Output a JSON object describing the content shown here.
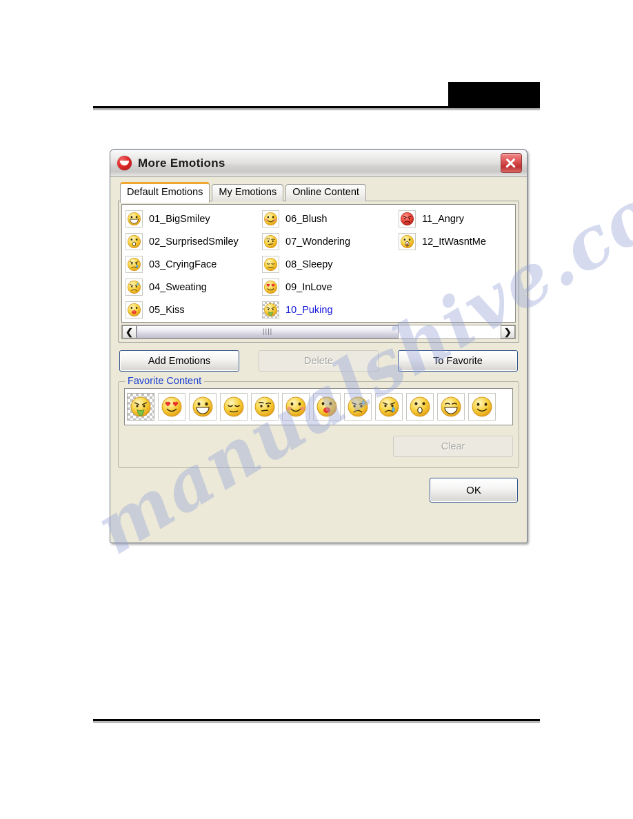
{
  "page": {
    "watermark": "manualshive.com",
    "has_top_rule": true,
    "has_bottom_rule": true,
    "redaction_block": true
  },
  "dialog": {
    "title": "More Emotions",
    "title_icon": "red-smiley-shield-icon",
    "close_label": "✕",
    "tabs": [
      {
        "label": "Default Emotions",
        "active": true
      },
      {
        "label": "My Emotions",
        "active": false
      },
      {
        "label": "Online Content",
        "active": false
      }
    ],
    "emotions": [
      {
        "name": "01_BigSmiley",
        "face": "big-smiley",
        "selected": false
      },
      {
        "name": "02_SurprisedSmiley",
        "face": "surprised",
        "selected": false
      },
      {
        "name": "03_CryingFace",
        "face": "crying",
        "selected": false
      },
      {
        "name": "04_Sweating",
        "face": "sweating",
        "selected": false
      },
      {
        "name": "05_Kiss",
        "face": "kiss",
        "selected": false
      },
      {
        "name": "06_Blush",
        "face": "blush",
        "selected": false
      },
      {
        "name": "07_Wondering",
        "face": "wondering",
        "selected": false
      },
      {
        "name": "08_Sleepy",
        "face": "sleepy",
        "selected": false
      },
      {
        "name": "09_InLove",
        "face": "in-love",
        "selected": false
      },
      {
        "name": "10_Puking",
        "face": "puking",
        "selected": true
      },
      {
        "name": "11_Angry",
        "face": "angry",
        "selected": false
      },
      {
        "name": "12_ItWasntMe",
        "face": "it-wasnt-me",
        "selected": false
      }
    ],
    "scrollbar": {
      "left_arrow": "❮",
      "right_arrow": "❯",
      "grip": "||||",
      "thumb_percent": 72
    },
    "buttons": {
      "add_emotions": {
        "label": "Add Emotions",
        "disabled": false
      },
      "delete": {
        "label": "Delete",
        "disabled": true
      },
      "to_favorite": {
        "label": "To Favorite",
        "disabled": false
      },
      "clear": {
        "label": "Clear",
        "disabled": true
      },
      "ok": {
        "label": "OK",
        "disabled": false
      }
    },
    "favorite_group": {
      "legend": "Favorite Content",
      "items": [
        {
          "face": "puking",
          "selected": true
        },
        {
          "face": "in-love",
          "selected": false
        },
        {
          "face": "big-smiley",
          "selected": false
        },
        {
          "face": "sleepy",
          "selected": false
        },
        {
          "face": "wondering",
          "selected": false
        },
        {
          "face": "blush",
          "selected": false
        },
        {
          "face": "kiss",
          "selected": false
        },
        {
          "face": "sweating",
          "selected": false
        },
        {
          "face": "crying",
          "selected": false
        },
        {
          "face": "surprised",
          "selected": false
        },
        {
          "face": "laughing",
          "selected": false
        },
        {
          "face": "smile",
          "selected": false
        }
      ]
    }
  },
  "colors": {
    "accent_tab": "#f0a732",
    "link_blue": "#1414dd",
    "legend_blue": "#1a3ed2",
    "close_red": "#c33232",
    "button_border": "#34568c",
    "dialog_face": "#ece9d8"
  }
}
